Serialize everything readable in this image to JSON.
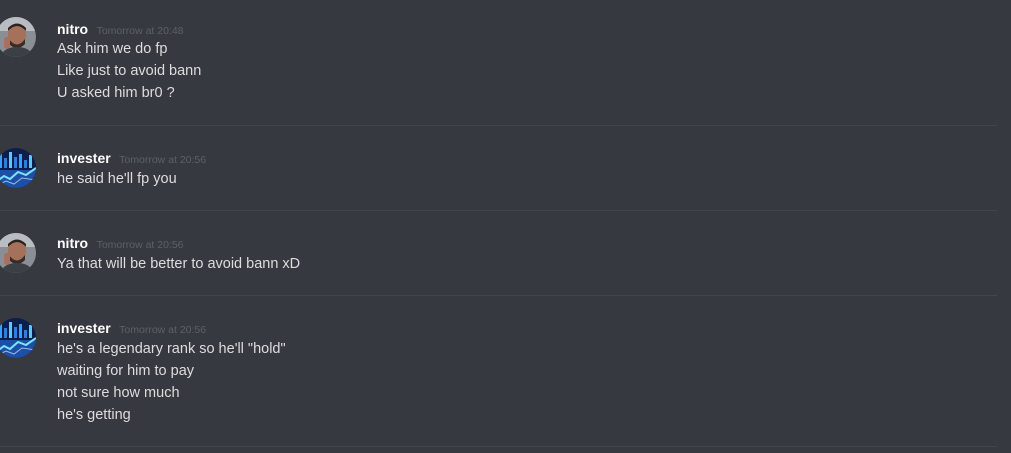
{
  "messages": [
    {
      "author": "nitro",
      "avatar": "avatar-nitro-icon",
      "timestamp": "Tomorrow at 20:48",
      "lines": [
        "Ask him we do fp",
        "Like just to avoid bann",
        "U asked him br0 ?"
      ]
    },
    {
      "author": "invester",
      "avatar": "avatar-invester-icon",
      "timestamp": "Tomorrow at 20:56",
      "lines": [
        "he said he'll fp you"
      ]
    },
    {
      "author": "nitro",
      "avatar": "avatar-nitro-icon",
      "timestamp": "Tomorrow at 20:56",
      "lines": [
        "Ya that will be better to avoid bann xD"
      ]
    },
    {
      "author": "invester",
      "avatar": "avatar-invester-icon",
      "timestamp": "Tomorrow at 20:56",
      "lines": [
        "he's a legendary rank so he'll \"hold\"",
        "waiting for him to pay",
        "not sure how much",
        "he's getting"
      ]
    }
  ],
  "colors": {
    "background": "#36393f",
    "username": "#ffffff",
    "timestamp": "#5d6067",
    "message_text": "#dcddde",
    "divider": "#42454b"
  }
}
